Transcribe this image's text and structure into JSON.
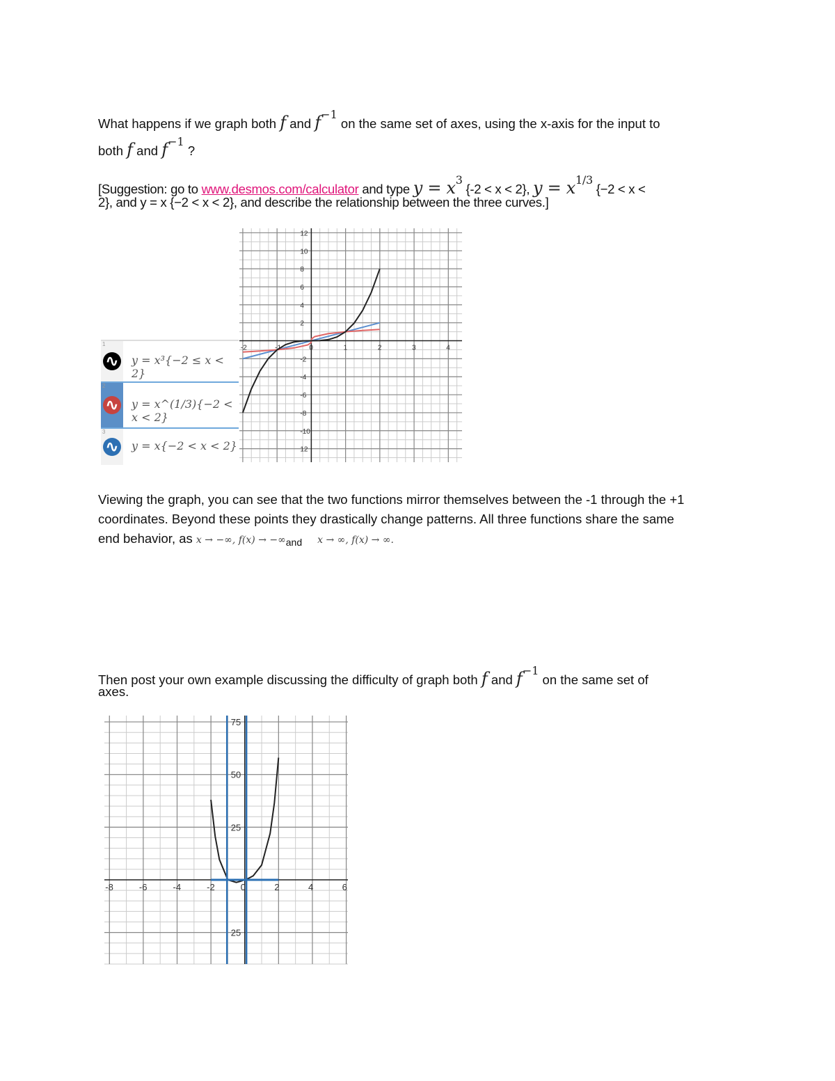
{
  "question": {
    "l1_a": "What happens if we graph both ",
    "f": "f",
    "and": " and ",
    "finv": "f",
    "inv_exp": "−1",
    "l1_b": " on the same set of axes, using the x-axis for the input to",
    "l2_a": "both ",
    "l2_end": " ?"
  },
  "suggestion": {
    "a": "[Suggestion: go to ",
    "link": "www.desmos.com/calculator",
    "b": " and type ",
    "eq1": "y = x",
    "eq1_exp": "3",
    "c": " {-2 < x < 2}, ",
    "eq2": "y = x",
    "eq2_exp": "1/3",
    "d": " {−2 < x <",
    "l2": "2}, and y = x {−2 < x < 2}, and describe the relationship between the three curves.]"
  },
  "answer": {
    "l1": "Viewing the graph, you can see that the two functions mirror themselves between the -1 through the +1",
    "l2": "coordinates. Beyond these points they drastically change patterns. All three functions share the same",
    "l3": "end behavior, as ",
    "math1": "x → −∞, f(x) → −∞",
    "and": "and",
    "math2": "x → ∞, f(x) → ∞."
  },
  "prompt2": {
    "l1_a": "Then post your own example discussing the difficulty of graph both ",
    "l1_b": " on the same set of",
    "l2": "axes."
  },
  "chart_data": [
    {
      "type": "line",
      "title": "",
      "x_ticks": [
        "-2",
        "-1",
        "0",
        "1",
        "2",
        "3",
        "4"
      ],
      "y_ticks": [
        "12",
        "10",
        "8",
        "6",
        "4",
        "2",
        "-2",
        "-4",
        "-6",
        "-8",
        "-10",
        "12"
      ],
      "xlim": [
        -2.1,
        4.4
      ],
      "ylim": [
        -13.5,
        12.5
      ],
      "grid": true,
      "legend": [
        {
          "num": "1",
          "text": "y = x³{−2 ≤ x < 2}",
          "color": "#000000",
          "icon": "wave-icon"
        },
        {
          "num": "2",
          "text": "y = x^(1/3){−2 < x < 2}",
          "color": "#c74440",
          "icon": "wave-icon"
        },
        {
          "num": "3",
          "text": "y = x{−2 < x < 2}",
          "color": "#2d70b3",
          "icon": "wave-icon"
        }
      ],
      "series": [
        {
          "color": "#222222",
          "x": [
            -2,
            -1.75,
            -1.5,
            -1.25,
            -1,
            -0.75,
            -0.5,
            -0.25,
            0,
            0.25,
            0.5,
            0.75,
            1,
            1.25,
            1.5,
            1.75,
            2
          ],
          "y": [
            -8,
            -5.36,
            -3.375,
            -1.953,
            -1,
            -0.422,
            -0.125,
            -0.016,
            0,
            0.016,
            0.125,
            0.422,
            1,
            1.953,
            3.375,
            5.36,
            8
          ]
        },
        {
          "color": "#e06666",
          "x": [
            -2,
            -1.5,
            -1,
            -0.5,
            -0.1,
            -0.01,
            0,
            0.01,
            0.1,
            0.5,
            1,
            1.5,
            2
          ],
          "y": [
            -1.26,
            -1.145,
            -1,
            -0.794,
            -0.464,
            -0.215,
            0,
            0.215,
            0.464,
            0.794,
            1,
            1.145,
            1.26
          ]
        },
        {
          "color": "#5b8fd0",
          "x": [
            -2,
            2
          ],
          "y": [
            -2,
            2
          ]
        }
      ]
    },
    {
      "type": "line",
      "title": "",
      "x_ticks": [
        "-8",
        "-6",
        "-4",
        "-2",
        "0",
        "2",
        "4",
        "6"
      ],
      "y_ticks": [
        "75",
        "50",
        "25",
        "25"
      ],
      "xlim": [
        -8.3,
        6.1
      ],
      "ylim": [
        -40,
        78
      ],
      "grid": true,
      "series": [
        {
          "color": "#222222",
          "x": [
            -2,
            -1.75,
            -1.5,
            -1,
            -0.5,
            -0.25,
            0,
            0.25,
            0.5,
            1,
            1.5,
            1.75,
            2
          ],
          "y": [
            38,
            20.7,
            9.65,
            0,
            -1.22,
            -0.7,
            0,
            0.81,
            1.91,
            7,
            22,
            36.5,
            58
          ]
        },
        {
          "color": "#2d70b3",
          "x": [
            -2,
            2
          ],
          "y": [
            0,
            0
          ]
        },
        {
          "color": "#2d70b3",
          "vertical_x": -1.05
        },
        {
          "color": "#2d70b3",
          "vertical_x": 0.1
        }
      ]
    }
  ]
}
